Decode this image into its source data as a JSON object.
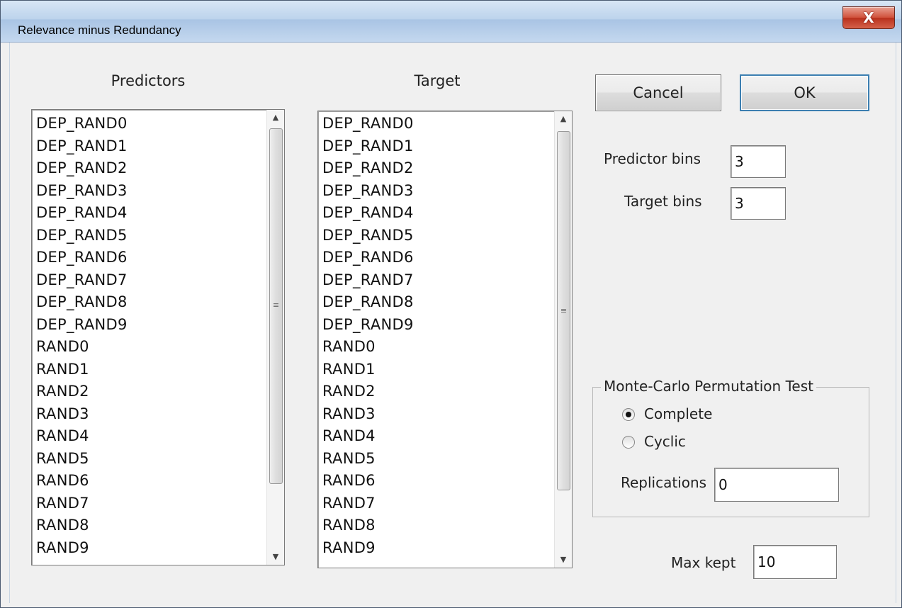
{
  "window": {
    "title": "Relevance minus Redundancy",
    "close_label": "X"
  },
  "predictors": {
    "heading": "Predictors",
    "items": [
      "DEP_RAND0",
      "DEP_RAND1",
      "DEP_RAND2",
      "DEP_RAND3",
      "DEP_RAND4",
      "DEP_RAND5",
      "DEP_RAND6",
      "DEP_RAND7",
      "DEP_RAND8",
      "DEP_RAND9",
      "RAND0",
      "RAND1",
      "RAND2",
      "RAND3",
      "RAND4",
      "RAND5",
      "RAND6",
      "RAND7",
      "RAND8",
      "RAND9"
    ]
  },
  "target": {
    "heading": "Target",
    "items": [
      "DEP_RAND0",
      "DEP_RAND1",
      "DEP_RAND2",
      "DEP_RAND3",
      "DEP_RAND4",
      "DEP_RAND5",
      "DEP_RAND6",
      "DEP_RAND7",
      "DEP_RAND8",
      "DEP_RAND9",
      "RAND0",
      "RAND1",
      "RAND2",
      "RAND3",
      "RAND4",
      "RAND5",
      "RAND6",
      "RAND7",
      "RAND8",
      "RAND9"
    ]
  },
  "buttons": {
    "cancel": "Cancel",
    "ok": "OK"
  },
  "bins": {
    "predictor_label": "Predictor bins",
    "predictor_value": "3",
    "target_label": "Target bins",
    "target_value": "3"
  },
  "monte_carlo": {
    "legend": "Monte-Carlo Permutation Test",
    "options": [
      {
        "label": "Complete",
        "selected": true
      },
      {
        "label": "Cyclic",
        "selected": false
      }
    ],
    "replications_label": "Replications",
    "replications_value": "0"
  },
  "max_kept": {
    "label": "Max kept",
    "value": "10"
  }
}
